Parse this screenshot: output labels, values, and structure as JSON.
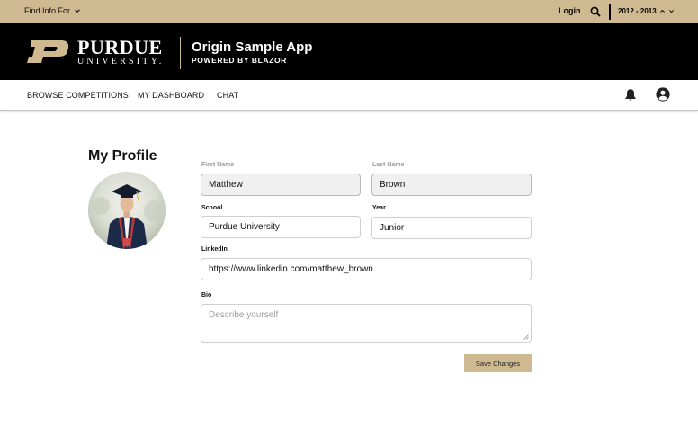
{
  "utility_bar": {
    "find_info": "Find Info For",
    "login": "Login",
    "year": "2012 - 2013"
  },
  "brand": {
    "logo_name": "PURDUE",
    "logo_sub": "UNIVERSITY.",
    "app_title": "Origin Sample App",
    "app_subtitle": "POWERED BY BLAZOR"
  },
  "nav": {
    "items": [
      {
        "label": "BROWSE COMPETITIONS"
      },
      {
        "label": "MY DASHBOARD"
      },
      {
        "label": "CHAT"
      }
    ]
  },
  "profile": {
    "title": "My Profile",
    "first_name": {
      "label": "First Name",
      "value": "Matthew"
    },
    "last_name": {
      "label": "Last Name",
      "value": "Brown"
    },
    "school": {
      "label": "School",
      "value": "Purdue University"
    },
    "year": {
      "label": "Year",
      "value": "Junior"
    },
    "linkedin": {
      "label": "LinkedIn",
      "value": "https://www.linkedin.com/matthew_brown"
    },
    "bio": {
      "label": "Bio",
      "placeholder": "Describe yourself"
    },
    "save_label": "Save Changes"
  },
  "colors": {
    "gold": "#cfb991",
    "black": "#000000",
    "input_border": "#cfcfcf"
  },
  "icons": [
    "chevron-down-icon",
    "search-icon",
    "bell-icon",
    "user-circle-icon",
    "resize-handle-icon"
  ]
}
